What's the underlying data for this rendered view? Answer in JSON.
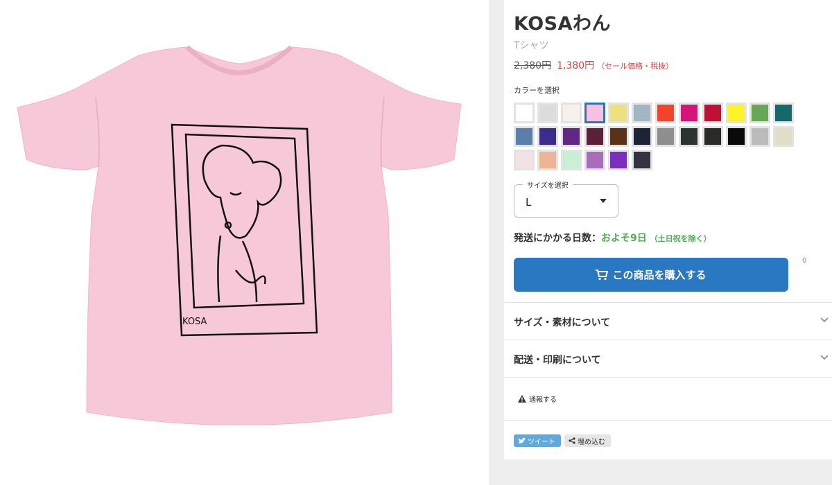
{
  "product": {
    "title": "KOSAわん",
    "subtitle": "Tシャツ",
    "price_old": "2,380円",
    "price_new": "1,380円",
    "price_note": "（セール価格・税抜）",
    "print_text": "KOSA"
  },
  "colors": {
    "label": "カラーを選択",
    "selected_index": 3,
    "swatches": [
      "#ffffff",
      "#dcdcdc",
      "#f6f1ec",
      "#f7bfe0",
      "#ece17f",
      "#a3b5c2",
      "#f0452c",
      "#d4147a",
      "#bc1236",
      "#fcf429",
      "#66a855",
      "#17686c",
      "#5a7fac",
      "#3b2c8e",
      "#622686",
      "#5e1f3b",
      "#5b3119",
      "#1d2438",
      "#8e8e90",
      "#2d3430",
      "#2a2a28",
      "#0a0a0a",
      "#bbbbbb",
      "#e1ddc6",
      "#f2e2e4",
      "#efb495",
      "#c9efd4",
      "#a86cbb",
      "#7c2fbe",
      "#333341"
    ]
  },
  "size": {
    "legend": "サイズを選択",
    "value": "L"
  },
  "shipping": {
    "label": "発送にかかる日数：",
    "days": "およそ9日",
    "note": "（土日祝を除く）"
  },
  "buy": {
    "label": "この商品を購入する",
    "fav_count": "0"
  },
  "sections": {
    "size_material": "サイズ・素材について",
    "delivery_print": "配送・印刷について"
  },
  "report": "通報する",
  "share": {
    "tweet": "ツイート",
    "embed": "埋め込む"
  }
}
